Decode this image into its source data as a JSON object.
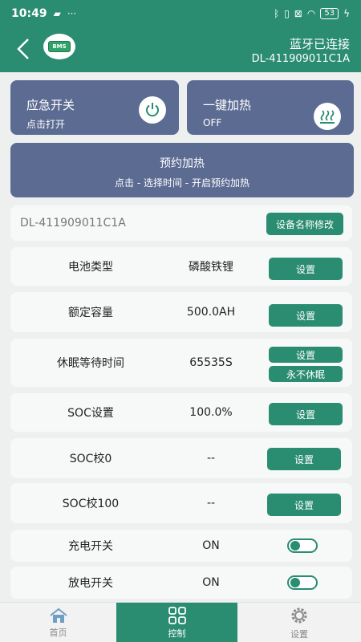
{
  "statusbar": {
    "time": "10:49",
    "battery": "53"
  },
  "header": {
    "logo_text": "BMS",
    "connection_status": "蓝牙已连接",
    "device_id": "DL-411909011C1A"
  },
  "emergency_switch": {
    "title": "应急开关",
    "subtitle": "点击打开"
  },
  "one_key_heating": {
    "title": "一键加热",
    "state": "OFF"
  },
  "scheduled_heating": {
    "title": "预约加热",
    "hint": "点击 - 选择时间 - 开启预约加热"
  },
  "device_name": {
    "value": "DL-411909011C1A",
    "button": "设备名称修改"
  },
  "rows": [
    {
      "label": "电池类型",
      "value": "磷酸铁锂",
      "button": "设置"
    },
    {
      "label": "额定容量",
      "value": "500.0AH",
      "button": "设置"
    },
    {
      "label": "休眠等待时间",
      "value": "65535S",
      "button": "设置",
      "button2": "永不休眠"
    },
    {
      "label": "SOC设置",
      "value": "100.0%",
      "button": "设置"
    },
    {
      "label": "SOC校0",
      "value": "--",
      "button": "设置"
    },
    {
      "label": "SOC校100",
      "value": "--",
      "button": "设置"
    }
  ],
  "switches": [
    {
      "label": "充电开关",
      "value": "ON",
      "on": true
    },
    {
      "label": "放电开关",
      "value": "ON",
      "on": true
    }
  ],
  "tabs": [
    {
      "label": "首页",
      "icon": "home-icon"
    },
    {
      "label": "控制",
      "icon": "grid-icon",
      "active": true
    },
    {
      "label": "设置",
      "icon": "gear-icon"
    }
  ],
  "colors": {
    "primary": "#2a8c70",
    "tile": "#5c6b92",
    "background": "#eef0f0"
  }
}
